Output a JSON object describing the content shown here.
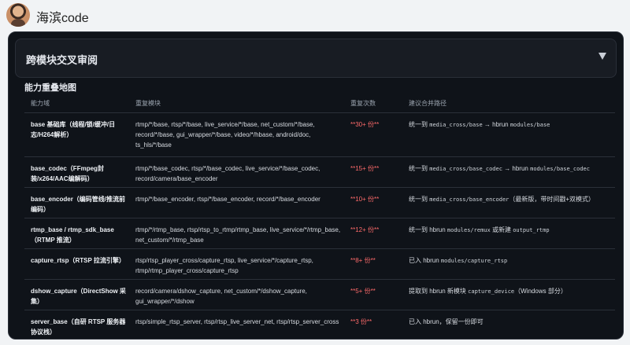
{
  "app": {
    "brand": "海滨code"
  },
  "section": {
    "header_title": "跨模块交叉审阅",
    "subtitle": "能力重叠地图"
  },
  "table": {
    "headers": [
      "能力域",
      "重复模块",
      "重复次数",
      "建议合并路径"
    ],
    "rows": [
      {
        "domain": "base 基础库（线程/锁/缓冲/日志/H264解析）",
        "modules": "rtmp/*/base, rtsp/*/base, live_service/*/base, net_custom/*/base, record/*/base, gui_wrapper/*/base, video/*/hbase, android/doc, ts_hls/*/base",
        "count": "**30+ 份**",
        "path_prefix": "统一到",
        "path_code1": "media_cross/base",
        "path_mid": "→ hbrun",
        "path_code2": "modules/base",
        "path_suffix": ""
      },
      {
        "domain": "base_codec（FFmpeg封装/x264/AAC编解码）",
        "modules": "rtmp/*/base_codec, rtsp/*/base_codec, live_service/*/base_codec, record/camera/base_encoder",
        "count": "**15+ 份**",
        "path_prefix": "统一到",
        "path_code1": "media_cross/base_codec",
        "path_mid": "→ hbrun",
        "path_code2": "modules/base_codec",
        "path_suffix": ""
      },
      {
        "domain": "base_encoder（编码管线/推流前编码）",
        "modules": "rtmp/*/base_encoder, rtsp/*/base_encoder, record/*/base_encoder",
        "count": "**10+ 份**",
        "path_prefix": "统一到",
        "path_code1": "media_cross/base_encoder",
        "path_mid": "（最新版，带时间戳+双模式）",
        "path_code2": "",
        "path_suffix": ""
      },
      {
        "domain": "rtmp_base / rtmp_sdk_base（RTMP 推流）",
        "modules": "rtmp/*/rtmp_base, rtsp/rtsp_to_rtmp/rtmp_base, live_service/*/rtmp_base, net_custom/*/rtmp_base",
        "count": "**12+ 份**",
        "path_prefix": "统一到 hbrun",
        "path_code1": "modules/remux",
        "path_mid": "或新建",
        "path_code2": "output_rtmp",
        "path_suffix": ""
      },
      {
        "domain": "capture_rtsp（RTSP 拉流引擎）",
        "modules": "rtsp/rtsp_player_cross/capture_rtsp, live_service/*/capture_rtsp, rtmp/rtmp_player_cross/capture_rtsp",
        "count": "**8+ 份**",
        "path_prefix": "已入 hbrun",
        "path_code1": "modules/capture_rtsp",
        "path_mid": "",
        "path_code2": "",
        "path_suffix": ""
      },
      {
        "domain": "dshow_capture（DirectShow 采集）",
        "modules": "record/camera/dshow_capture, net_custom/*/dshow_capture, gui_wrapper/*/dshow",
        "count": "**5+ 份**",
        "path_prefix": "提取到 hbrun 新模块",
        "path_code1": "capture_device",
        "path_mid": "（Windows 部分）",
        "path_code2": "",
        "path_suffix": ""
      },
      {
        "domain": "server_base（自研 RTSP 服务器协议栈）",
        "modules": "rtsp/simple_rtsp_server, rtsp/rtsp_live_server_net, rtsp/rtsp_server_cross",
        "count": "**3 份**",
        "path_prefix": "已入 hbrun，保留一份即可",
        "path_code1": "",
        "path_mid": "",
        "path_code2": "",
        "path_suffix": ""
      }
    ]
  },
  "colors": {
    "panel_bg": "#0f1319",
    "count_red": "#ff6b6b",
    "text": "#d7dbe1"
  }
}
